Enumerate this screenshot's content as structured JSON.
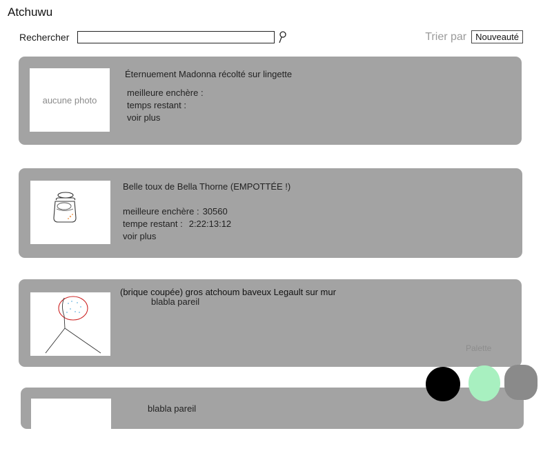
{
  "app": {
    "title": "Atchuwu"
  },
  "search": {
    "label": "Rechercher",
    "value": "",
    "icon": "search-icon"
  },
  "sort": {
    "label": "Trier par",
    "selected": "Nouveauté"
  },
  "listings": [
    {
      "title": "Éternuement Madonna récolté sur lingette",
      "photo_placeholder": "aucune photo",
      "best_bid_label": "meilleure enchère :",
      "best_bid_value": "",
      "time_left_label": "temps restant :",
      "time_left_value": "",
      "see_more": "voir plus"
    },
    {
      "title": "Belle toux de Bella Thorne (EMPOTTÉE !)",
      "best_bid_label": "meilleure enchère :",
      "best_bid_value": "30560",
      "time_left_label": "tempe restant :",
      "time_left_value": "2:22:13:12",
      "see_more": "voir plus"
    },
    {
      "title": "(brique coupée) gros atchoum baveux Legault sur mur",
      "description": "blabla pareil"
    },
    {
      "description": "blabla pareil"
    }
  ],
  "palette": {
    "label": "Palette",
    "colors": [
      "#000000",
      "#a8f0c0",
      "#8a8a8a"
    ]
  }
}
